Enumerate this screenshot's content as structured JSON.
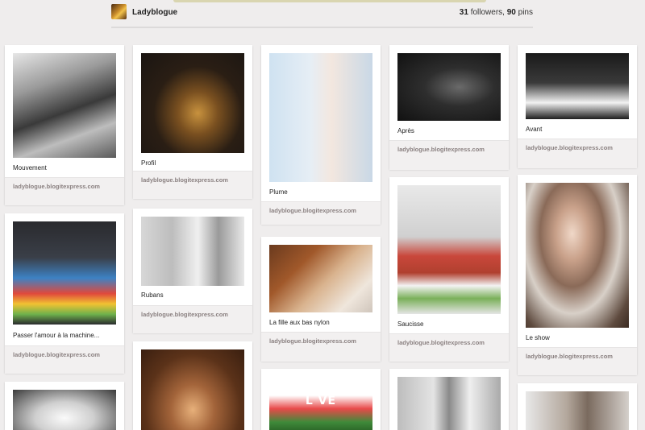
{
  "header": {
    "board_name": "Ladyblogue",
    "followers_count": "31",
    "followers_label": "followers,",
    "pins_count": "90",
    "pins_label": "pins"
  },
  "pins": [
    {
      "caption": "Mouvement",
      "source": "ladyblogue.blogitexpress.com"
    },
    {
      "caption": "Profil",
      "source": "ladyblogue.blogitexpress.com"
    },
    {
      "caption": "Plume",
      "source": "ladyblogue.blogitexpress.com"
    },
    {
      "caption": "Après",
      "source": "ladyblogue.blogitexpress.com"
    },
    {
      "caption": "Avant",
      "source": "ladyblogue.blogitexpress.com"
    },
    {
      "caption": "Passer l'amour à la machine...",
      "source": "ladyblogue.blogitexpress.com"
    },
    {
      "caption": "Rubans",
      "source": "ladyblogue.blogitexpress.com"
    },
    {
      "caption": "La fille aux bas nylon",
      "source": "ladyblogue.blogitexpress.com"
    },
    {
      "caption": "Saucisse",
      "source": "ladyblogue.blogitexpress.com"
    },
    {
      "caption": "Le show",
      "source": "ladyblogue.blogitexpress.com"
    }
  ],
  "love_text": "L   VE",
  "colors": {
    "background": "#efeded",
    "source_text": "#8a8080",
    "accent_strip": "#d9d5b0"
  }
}
